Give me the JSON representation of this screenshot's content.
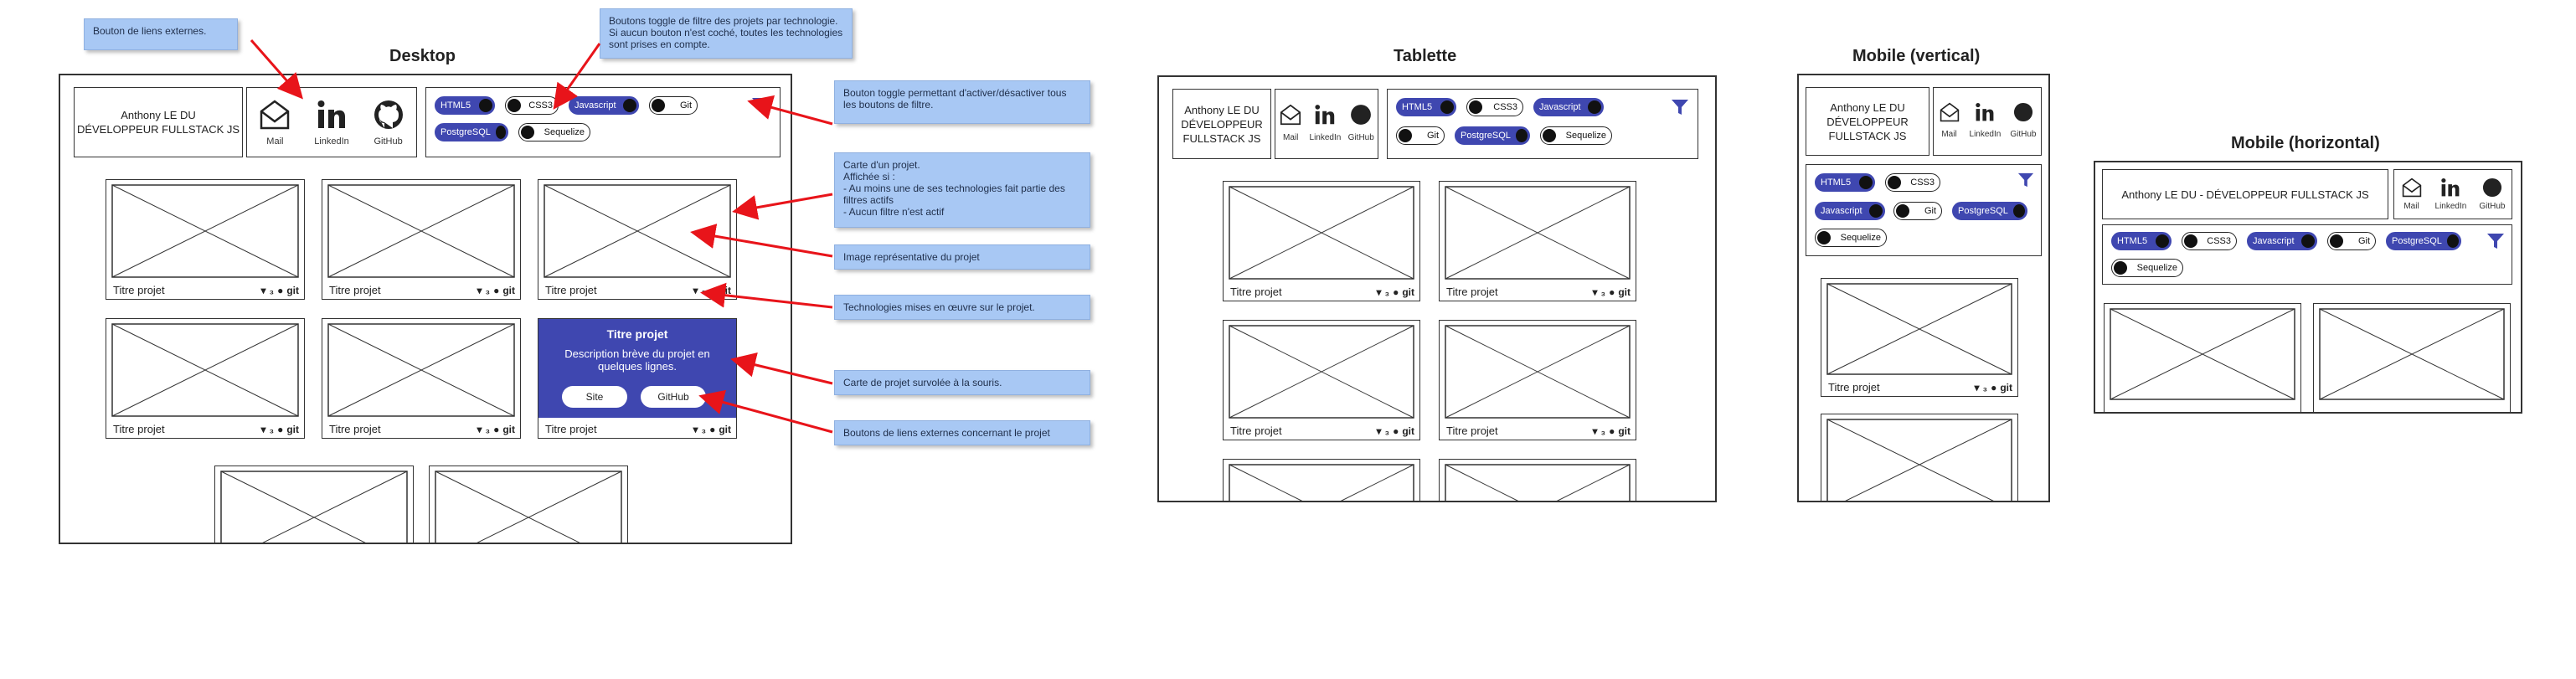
{
  "headings": {
    "desktop": "Desktop",
    "tablet": "Tablette",
    "mobile_v": "Mobile (vertical)",
    "mobile_h": "Mobile (horizontal)"
  },
  "profile": {
    "name": "Anthony LE DU",
    "title": "DÉVELOPPEUR FULLSTACK JS",
    "title_tablet_l1": "DÉVELOPPEUR",
    "title_tablet_l2": "FULLSTACK JS",
    "inline": "Anthony LE DU - DÉVELOPPEUR FULLSTACK JS"
  },
  "links": {
    "mail": "Mail",
    "linkedin": "LinkedIn",
    "github": "GitHub"
  },
  "filters": {
    "html5": "HTML5",
    "css3": "CSS3",
    "javascript": "Javascript",
    "git": "Git",
    "postgresql": "PostgreSQL",
    "sequelize": "Sequelize"
  },
  "card": {
    "title": "Titre projet",
    "git": "git",
    "hover_title": "Titre projet",
    "hover_desc": "Description brève du projet en quelques lignes.",
    "site": "Site",
    "github": "GitHub"
  },
  "notes": {
    "external": "Bouton de liens externes.",
    "filter_toggles": "Boutons toggle de filtre des projets par technologie. Si aucun bouton n'est coché, toutes les technologies sont prises en compte.",
    "toggle_all": "Bouton toggle permettant d'activer/désactiver tous les boutons de filtre.",
    "card_l1": "Carte d'un projet.",
    "card_l2": "Affichée si :",
    "card_l3": "- Au moins une de ses technologies fait partie des filtres actifs",
    "card_l4": "- Aucun filtre n'est actif",
    "image": "Image représentative du projet",
    "techs": "Technologies mises en œuvre sur le projet.",
    "hovered": "Carte de projet survolée à la souris.",
    "ext_project": "Boutons de liens externes concernant le projet"
  },
  "colors": {
    "accent": "#3f47b0",
    "note": "#a8c8f4",
    "arrow": "#e8141a"
  }
}
